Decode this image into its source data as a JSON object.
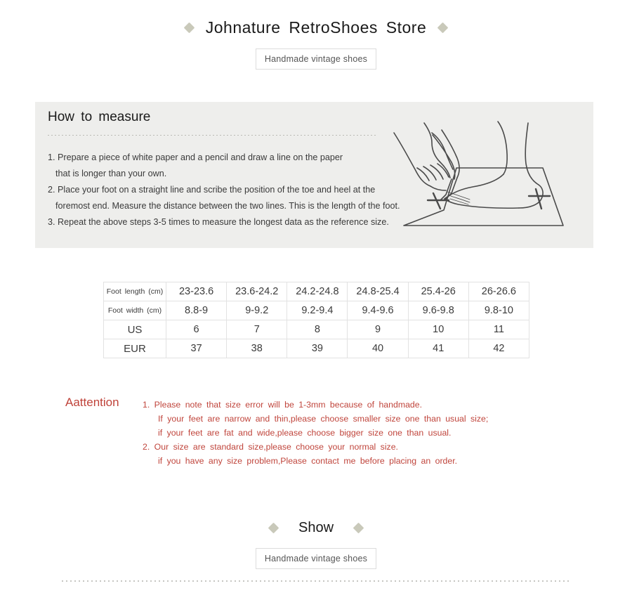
{
  "page": {
    "background": "#ffffff",
    "accent_diamond_color": "#c9c9ba",
    "attention_color": "#bf4239",
    "panel_color": "#eeeeec"
  },
  "store_header": {
    "title": "Johnature  RetroShoes  Store",
    "left_diamond": "diamond-icon",
    "right_diamond": "diamond-icon"
  },
  "tagline_top": {
    "text": "Handmade vintage shoes"
  },
  "measure": {
    "title": "How  to  measure",
    "steps": [
      "1. Prepare a piece of white paper and a pencil and draw a line on the paper",
      "that is longer than your own.",
      "2. Place your foot on a straight line and scribe the position of the toe and heel at the",
      "foremost end. Measure the distance between the two lines. This is the length of the foot.",
      "3. Repeat the above steps 3-5 times to measure the longest data as the reference size."
    ],
    "illustration_name": "foot-tracing-illustration"
  },
  "size_table": {
    "rows": [
      {
        "label": "Foot  length (cm)",
        "label_style": "small",
        "values": [
          "23-23.6",
          "23.6-24.2",
          "24.2-24.8",
          "24.8-25.4",
          "25.4-26",
          "26-26.6"
        ]
      },
      {
        "label": "Foot  width  (cm)",
        "label_style": "small",
        "values": [
          "8.8-9",
          "9-9.2",
          "9.2-9.4",
          "9.4-9.6",
          "9.6-9.8",
          "9.8-10"
        ]
      },
      {
        "label": "US",
        "label_style": "big",
        "values": [
          "6",
          "7",
          "8",
          "9",
          "10",
          "11"
        ]
      },
      {
        "label": "EUR",
        "label_style": "big",
        "values": [
          "37",
          "38",
          "39",
          "40",
          "41",
          "42"
        ]
      }
    ]
  },
  "attention": {
    "title": "Aattention",
    "lines": [
      {
        "text": "1.  Please  note  that  size  error  will  be  1-3mm  because  of  handmade.",
        "sub": false
      },
      {
        "text": "If  your  feet  are  narrow  and  thin,please  choose  smaller  size  one  than  usual  size;",
        "sub": true
      },
      {
        "text": "if  your  feet  are  fat  and  wide,please  choose  bigger  size  one  than  usual.",
        "sub": true
      },
      {
        "text": "2.  Our  size  are  standard  size,please  choose  your  normal  size.",
        "sub": false
      },
      {
        "text": "if  you  have  any  size  problem,Please  contact  me  before  placing  an  order.",
        "sub": true
      }
    ]
  },
  "show_header": {
    "title": "Show",
    "left_diamond": "diamond-icon",
    "right_diamond": "diamond-icon"
  },
  "tagline_bottom": {
    "text": "Handmade vintage shoes"
  }
}
